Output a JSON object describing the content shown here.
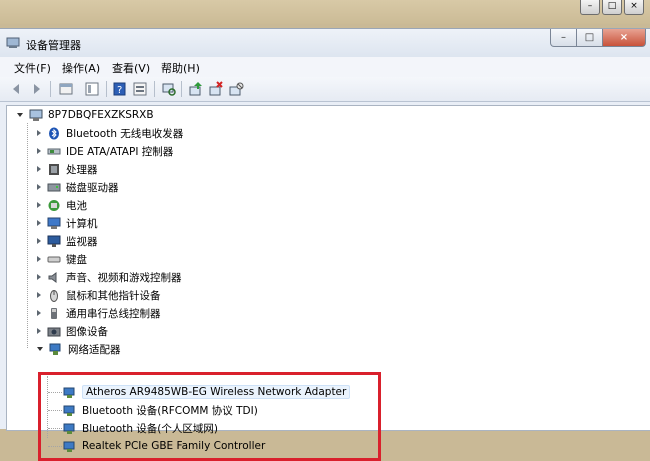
{
  "window": {
    "title": "设备管理器"
  },
  "menu": [
    "文件(F)",
    "操作(A)",
    "查看(V)",
    "帮助(H)"
  ],
  "tree": {
    "root": "8P7DBQFEXZKSRXB",
    "categories": [
      "Bluetooth 无线电收发器",
      "IDE ATA/ATAPI 控制器",
      "处理器",
      "磁盘驱动器",
      "电池",
      "计算机",
      "监视器",
      "键盘",
      "声音、视频和游戏控制器",
      "鼠标和其他指针设备",
      "通用串行总线控制器",
      "图像设备",
      "网络适配器"
    ],
    "network_adapters": [
      "Atheros AR9485WB-EG Wireless Network Adapter",
      "Bluetooth 设备(RFCOMM 协议 TDI)",
      "Bluetooth 设备(个人区域网)",
      "Realtek PCIe GBE Family Controller"
    ]
  },
  "colors": {
    "highlight_border": "#d9202c",
    "tree_background": "#ffffff"
  },
  "icons": {
    "toolbar": [
      "back-icon",
      "forward-icon",
      "up-icon",
      "show-hide-tree-icon",
      "help-icon",
      "properties-icon",
      "scan-hardware-icon",
      "update-driver-icon",
      "uninstall-icon",
      "disable-icon"
    ]
  }
}
